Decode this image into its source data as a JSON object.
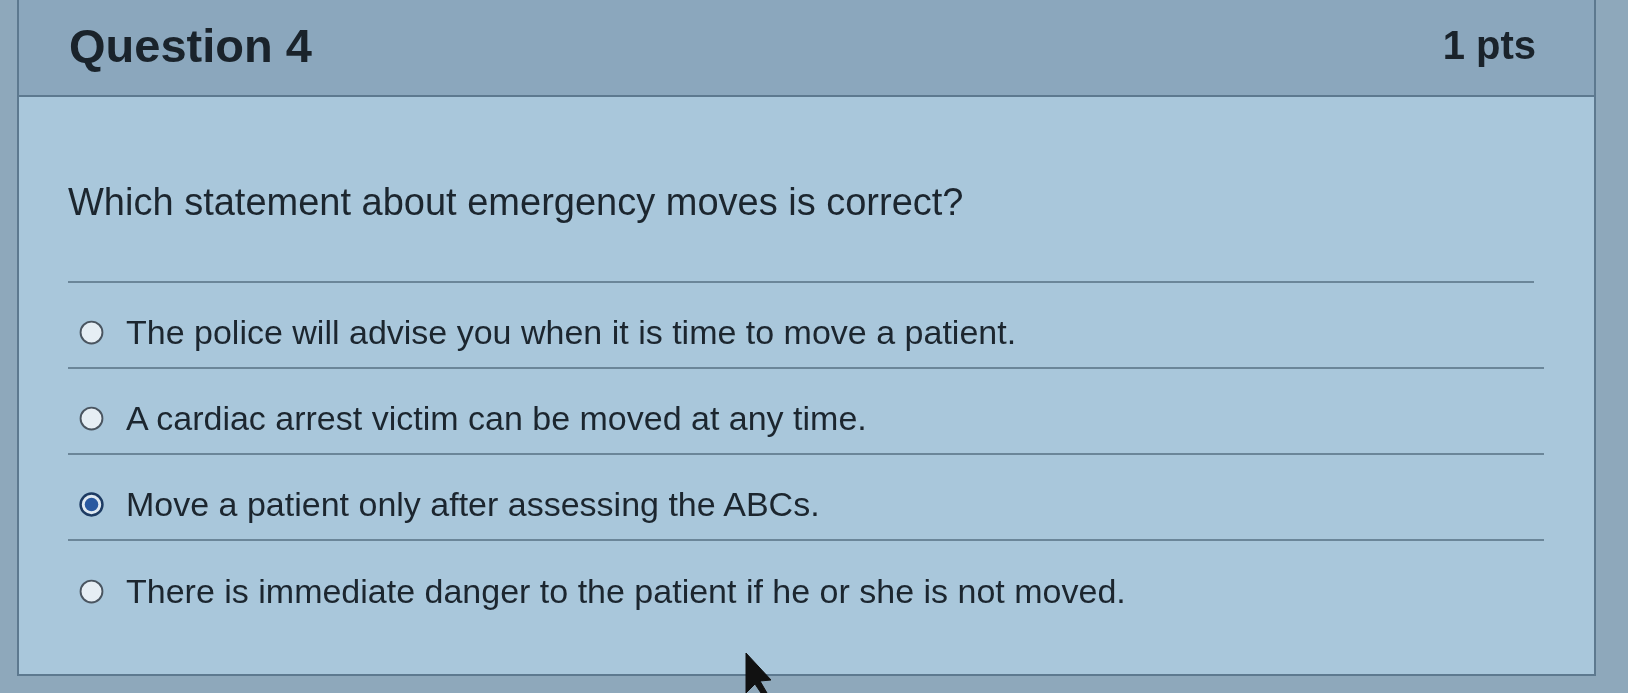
{
  "question": {
    "title": "Question 4",
    "points": "1 pts",
    "text": "Which statement about emergency moves is correct?"
  },
  "options": [
    {
      "label": "The police will advise you when it is time to move a patient.",
      "selected": false
    },
    {
      "label": "A cardiac arrest victim can be moved at any time.",
      "selected": false
    },
    {
      "label": "Move a patient only after assessing the ABCs.",
      "selected": true
    },
    {
      "label": "There is immediate danger to the patient if he or she is not moved.",
      "selected": false
    }
  ]
}
